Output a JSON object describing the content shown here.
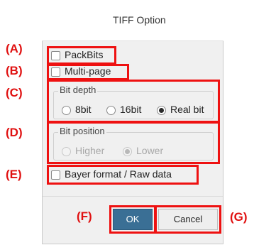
{
  "dialog": {
    "title": "TIFF Option"
  },
  "labels": {
    "a": "(A)",
    "b": "(B)",
    "c": "(C)",
    "d": "(D)",
    "e": "(E)",
    "f": "(F)",
    "g": "(G)"
  },
  "options": {
    "packbits": "PackBits",
    "multipage": "Multi-page",
    "bayer": "Bayer format / Raw data"
  },
  "bit_depth": {
    "title": "Bit depth",
    "items": [
      "8bit",
      "16bit",
      "Real bit"
    ],
    "selected": "Real bit"
  },
  "bit_position": {
    "title": "Bit position",
    "items": [
      "Higher",
      "Lower"
    ],
    "selected": "Lower",
    "disabled": true
  },
  "buttons": {
    "ok": "OK",
    "cancel": "Cancel"
  }
}
